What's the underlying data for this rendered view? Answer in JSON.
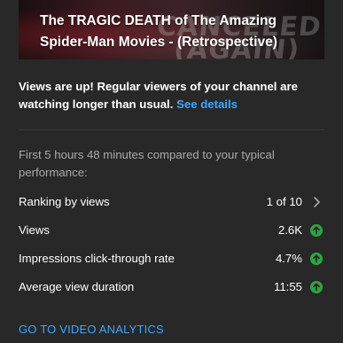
{
  "video": {
    "title": "The TRAGIC DEATH of The Amazing Spider-Man Movies - (Retrospective)",
    "thumbnail_overlay": "CANCELED (AGAIN)"
  },
  "message": {
    "text": "Views are up! Regular viewers of your channel are watching longer than usual.",
    "link": "See details"
  },
  "comparison": {
    "subtitle": "First 5 hours 48 minutes compared to your typical performance:"
  },
  "metrics": [
    {
      "label": "Ranking by views",
      "value": "1 of 10",
      "icon": "chevron-right-icon"
    },
    {
      "label": "Views",
      "value": "2.6K",
      "icon": "arrow-up-icon"
    },
    {
      "label": "Impressions click-through rate",
      "value": "4.7%",
      "icon": "arrow-up-icon"
    },
    {
      "label": "Average view duration",
      "value": "11:55",
      "icon": "arrow-up-icon"
    }
  ],
  "cta": {
    "label": "GO TO VIDEO ANALYTICS"
  },
  "colors": {
    "background": "#282828",
    "link": "#3ea6ff",
    "positive": "#2ba640",
    "muted_text": "#aaaaaa"
  }
}
